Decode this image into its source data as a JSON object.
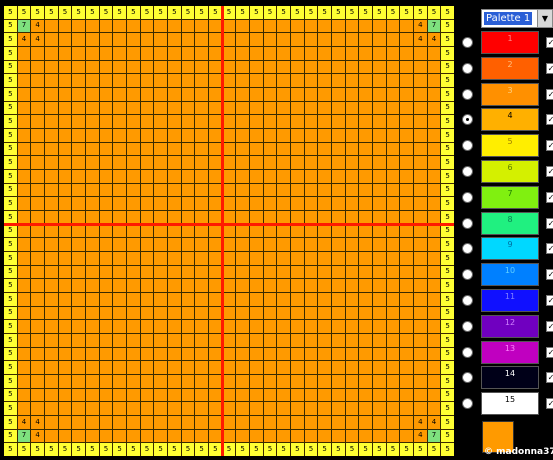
{
  "grid": {
    "size": 33,
    "default_color": "#ff9a00",
    "axis_color": "#ff1a00",
    "cell_colors": {
      "5": "#ffff33",
      "7": "#7ee07e",
      "4": "#ff9a00"
    },
    "marks": [
      [
        1,
        1,
        "7"
      ],
      [
        1,
        2,
        "4"
      ],
      [
        2,
        1,
        "4"
      ],
      [
        2,
        2,
        "4"
      ],
      [
        1,
        31,
        "7"
      ],
      [
        1,
        30,
        "4"
      ],
      [
        2,
        31,
        "4"
      ],
      [
        2,
        30,
        "4"
      ],
      [
        31,
        1,
        "7"
      ],
      [
        31,
        2,
        "4"
      ],
      [
        30,
        1,
        "4"
      ],
      [
        30,
        2,
        "4"
      ],
      [
        31,
        31,
        "7"
      ],
      [
        31,
        30,
        "4"
      ],
      [
        30,
        31,
        "4"
      ],
      [
        30,
        30,
        "4"
      ]
    ],
    "border_value": "5"
  },
  "palette_select": {
    "value": "Palette 1",
    "arrow_icon": "chevron-down-icon"
  },
  "palette": {
    "selected_index": 3,
    "colors": [
      {
        "label": "1",
        "bg": "#ff0000",
        "fg": "#ff8a8a"
      },
      {
        "label": "2",
        "bg": "#ff6000",
        "fg": "#ffc080"
      },
      {
        "label": "3",
        "bg": "#ff9000",
        "fg": "#ffd080"
      },
      {
        "label": "4",
        "bg": "#ffb000",
        "fg": "#000000"
      },
      {
        "label": "5",
        "bg": "#ffee00",
        "fg": "#a08000"
      },
      {
        "label": "6",
        "bg": "#d4f000",
        "fg": "#608000"
      },
      {
        "label": "7",
        "bg": "#80f010",
        "fg": "#208000"
      },
      {
        "label": "8",
        "bg": "#20f080",
        "fg": "#0a8050"
      },
      {
        "label": "9",
        "bg": "#00d8ff",
        "fg": "#0070a0"
      },
      {
        "label": "10",
        "bg": "#0080ff",
        "fg": "#60d0ff"
      },
      {
        "label": "11",
        "bg": "#1010ff",
        "fg": "#8080ff"
      },
      {
        "label": "12",
        "bg": "#7000c0",
        "fg": "#d080ff"
      },
      {
        "label": "13",
        "bg": "#c000c0",
        "fg": "#ff80ff"
      },
      {
        "label": "14",
        "bg": "#000018",
        "fg": "#ffffff"
      },
      {
        "label": "15",
        "bg": "#ffffff",
        "fg": "#000000"
      }
    ]
  },
  "current_color": "#ff9a00",
  "watermark": "© madonna37"
}
